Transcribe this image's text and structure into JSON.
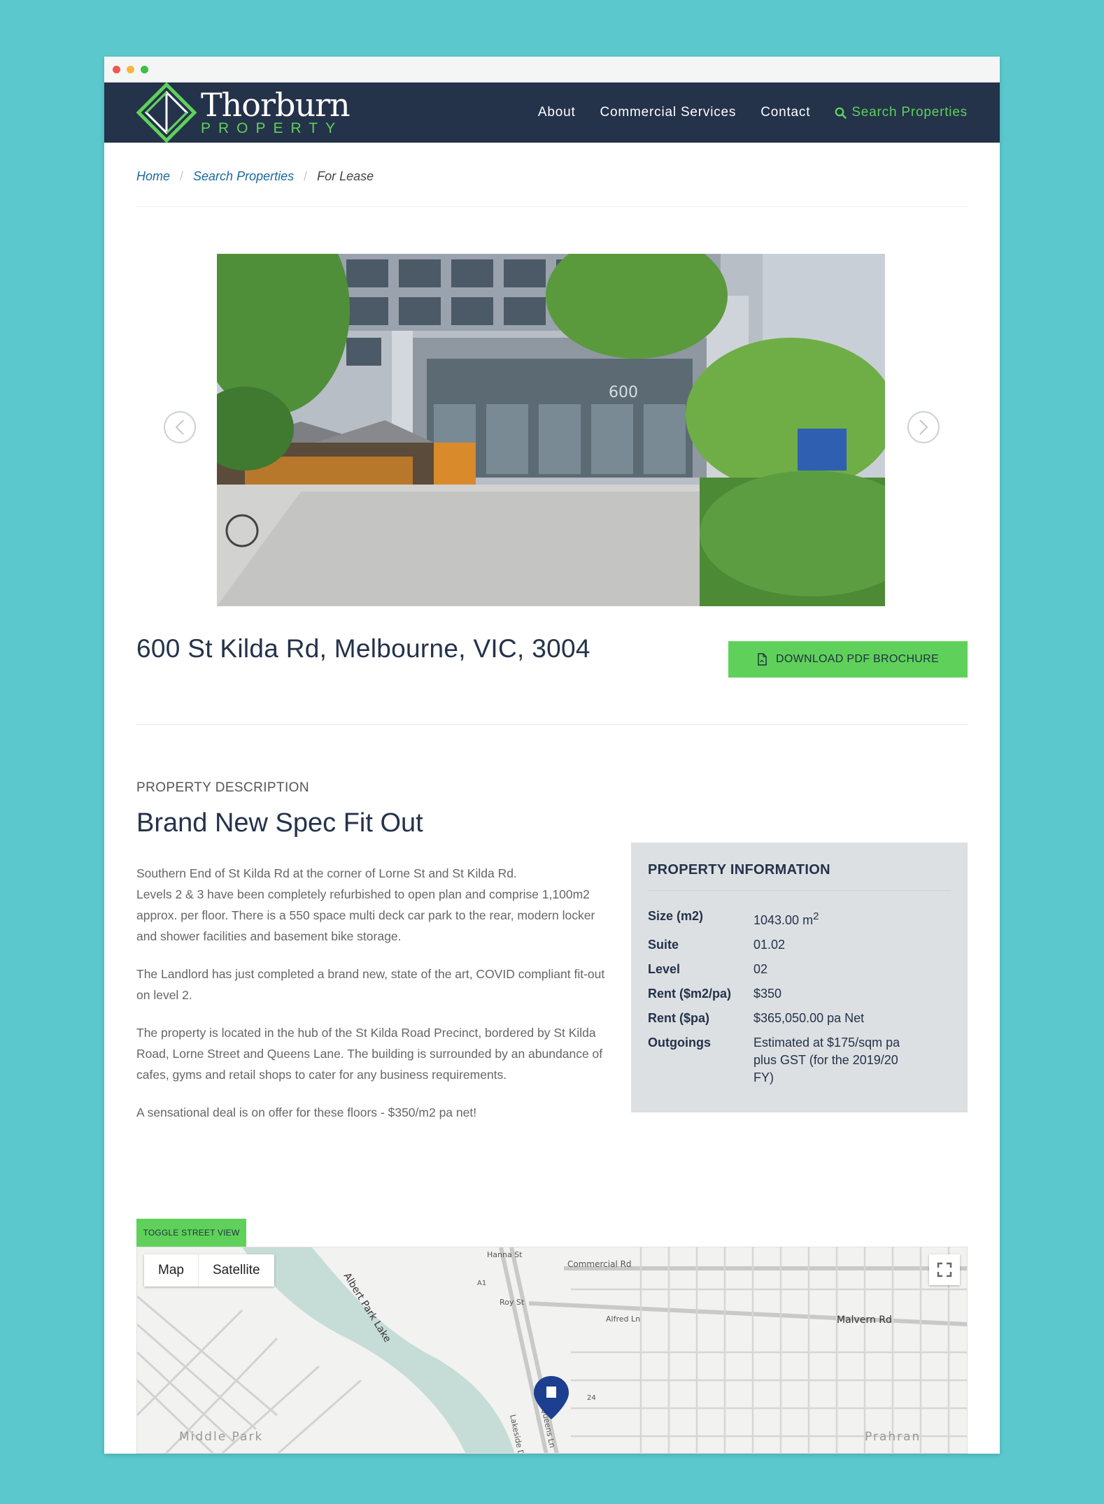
{
  "brand": {
    "name": "Thorburn",
    "tagline": "PROPERTY",
    "accent": "#5fd15a",
    "navy": "#24324a"
  },
  "nav": {
    "about": "About",
    "commercial": "Commercial Services",
    "contact": "Contact",
    "search": "Search Properties"
  },
  "breadcrumb": {
    "home": "Home",
    "search": "Search Properties",
    "current": "For Lease"
  },
  "slider": {
    "image_alt": "Office building entrance with number 600",
    "building_number": "600"
  },
  "property": {
    "address": "600 St Kilda Rd, Melbourne, VIC, 3004",
    "download_label": "DOWNLOAD PDF BROCHURE"
  },
  "description": {
    "eyebrow": "PROPERTY DESCRIPTION",
    "title": "Brand New Spec Fit Out",
    "paragraphs": [
      "Southern End of St Kilda Rd at the corner of Lorne St and St Kilda Rd.",
      "Levels 2 & 3 have been completely refurbished to open plan and comprise 1,100m2 approx. per floor. There is a 550 space multi deck car park to the rear, modern locker and shower facilities and basement bike storage.",
      "The Landlord has just completed a brand new, state of the art, COVID compliant fit-out on level 2.",
      "The property is located in the hub of the St Kilda Road Precinct, bordered by St Kilda Road, Lorne Street and Queens Lane. The building is surrounded by an abundance of cafes, gyms and retail shops to cater for any business requirements.",
      "A sensational deal is on offer for these floors - $350/m2 pa net!"
    ]
  },
  "info": {
    "title": "PROPERTY INFORMATION",
    "rows": [
      {
        "label": "Size (m2)",
        "value": "1043.00 m",
        "sup": "2"
      },
      {
        "label": "Suite",
        "value": "01.02"
      },
      {
        "label": "Level",
        "value": "02"
      },
      {
        "label": "Rent ($m2/pa)",
        "value": "$350"
      },
      {
        "label": "Rent ($pa)",
        "value": "$365,050.00 pa Net"
      },
      {
        "label": "Outgoings",
        "value": "Estimated at $175/sqm pa plus GST (for the 2019/20 FY)"
      }
    ]
  },
  "map": {
    "toggle_label": "TOGGLE STREET VIEW",
    "type_map": "Map",
    "type_satellite": "Satellite",
    "labels": {
      "lake": "Albert Park Lake",
      "malvern": "Malvern Rd",
      "commercial": "Commercial Rd",
      "middle_park": "Middle Park",
      "prahran": "Prahran",
      "queens": "Queens Ln",
      "lakeside": "Lakeside Dr",
      "alfred": "Alfred Ln",
      "roy": "Roy St",
      "hanna": "Hanna St",
      "a1": "A1",
      "route": "24"
    }
  }
}
